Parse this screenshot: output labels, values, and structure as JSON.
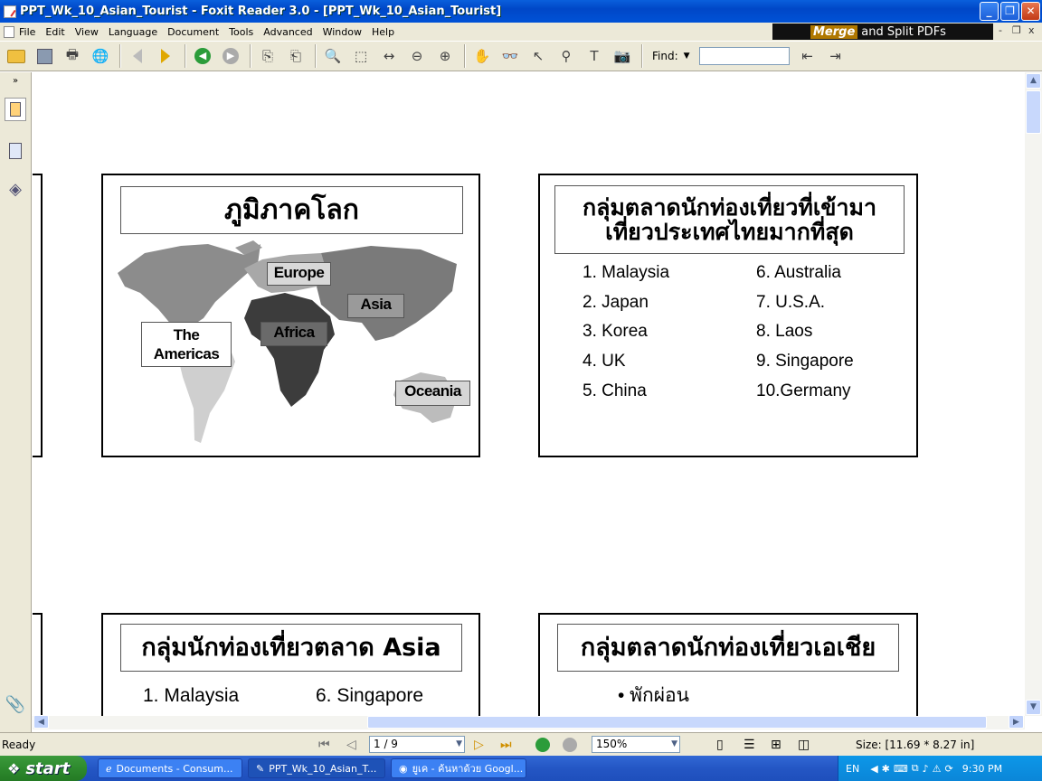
{
  "window": {
    "title": "PPT_Wk_10_Asian_Tourist - Foxit Reader 3.0 - [PPT_Wk_10_Asian_Tourist]",
    "minimize": "_",
    "restore": "❐",
    "close": "✕"
  },
  "menu": {
    "items": [
      "File",
      "Edit",
      "View",
      "Language",
      "Document",
      "Tools",
      "Advanced",
      "Window",
      "Help"
    ],
    "ad_highlight": "Merge",
    "ad_text": "and Split PDFs",
    "mdi_min": "-",
    "mdi_restore": "❐",
    "mdi_close": "x"
  },
  "toolbar": {
    "find_label": "Find:",
    "find_value": ""
  },
  "slides": {
    "world": {
      "title": "ภูมิภาคโลก",
      "labels": {
        "europe": "Europe",
        "asia": "Asia",
        "africa": "Africa",
        "americas_1": "The",
        "americas_2": "Americas",
        "oceania": "Oceania"
      }
    },
    "markets": {
      "title_line1": "กลุ่มตลาดนักท่องเที่ยวที่เข้ามา",
      "title_line2": "เที่ยวประเทศไทยมากที่สุด",
      "col1": [
        "1. Malaysia",
        "2. Japan",
        "3. Korea",
        "4. UK",
        "5. China"
      ],
      "col2": [
        "6. Australia",
        "7. U.S.A.",
        "8. Laos",
        "9. Singapore",
        "10.Germany"
      ]
    },
    "asia_groups": {
      "title": "กลุ่มนักท่องเที่ยวตลาด Asia",
      "item1": "1. Malaysia",
      "item6": "6. Singapore"
    },
    "asia_markets": {
      "title": "กลุ่มตลาดนักท่องเที่ยวเอเชีย",
      "bullet1": "• พักผ่อน"
    }
  },
  "status": {
    "ready": "Ready",
    "page": "1 / 9",
    "zoom": "150%",
    "size": "Size: [11.69 * 8.27 in]"
  },
  "taskbar": {
    "start": "start",
    "tasks": [
      "Documents - Consum...",
      "PPT_Wk_10_Asian_T...",
      "ยูเค - ค้นหาด้วย Googl..."
    ],
    "lang": "EN",
    "time": "9:30 PM"
  }
}
